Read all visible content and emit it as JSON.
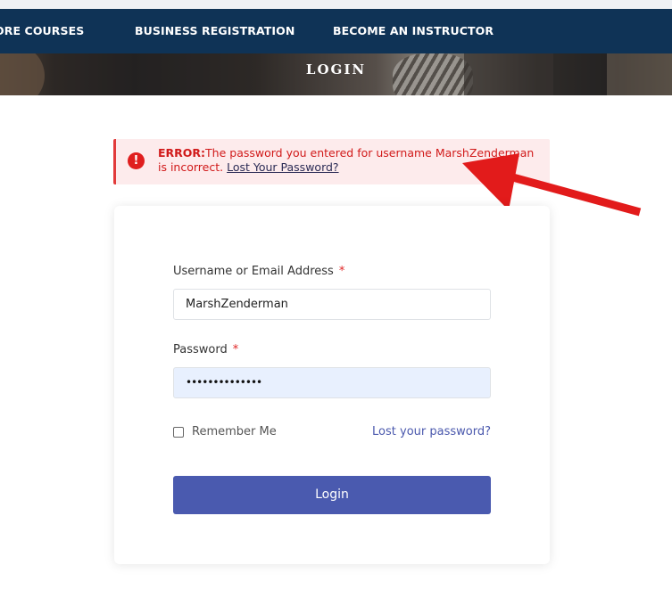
{
  "nav": {
    "items": [
      "ORE COURSES",
      "BUSINESS REGISTRATION",
      "BECOME AN INSTRUCTOR"
    ]
  },
  "hero": {
    "title": "LOGIN"
  },
  "error": {
    "label": "ERROR:",
    "message": "The password you entered for username MarshZenderman is incorrect.",
    "link": "Lost Your Password?",
    "icon": "exclamation-circle-icon",
    "color": "#e01e1e"
  },
  "form": {
    "username_label": "Username or Email Address",
    "username_value": "MarshZenderman",
    "password_label": "Password",
    "password_value": "••••••••••••••",
    "required_mark": "*",
    "remember_label": "Remember Me",
    "lost_password": "Lost your password?",
    "login_button": "Login"
  },
  "colors": {
    "nav_bg": "#0f3356",
    "button_bg": "#4a5aaf",
    "link": "#4a58ad",
    "annotation_arrow": "#e21b1b"
  },
  "annotation": {
    "icon": "red-arrow-icon"
  }
}
